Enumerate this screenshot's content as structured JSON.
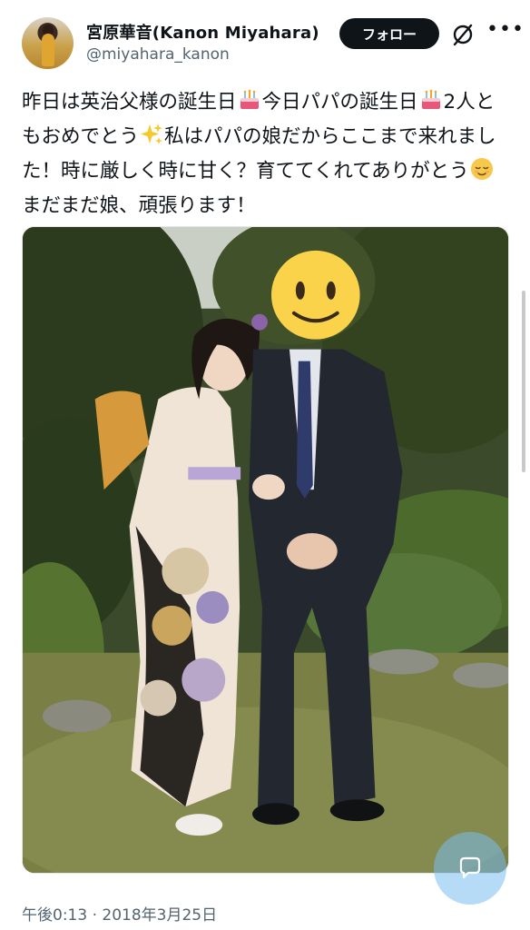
{
  "author": {
    "display_name": "宮原華音(Kanon Miyahara)",
    "handle": "@miyahara_kanon",
    "avatar_icon": "profile-photo"
  },
  "actions": {
    "follow_label": "フォロー",
    "grok_icon": "slash-circle-icon",
    "more_icon": "more-horizontal-icon"
  },
  "tweet": {
    "text_1": "昨日は英治父様の誕生日",
    "text_2": "今日パパの誕生日",
    "text_3": "2人ともおめでとう",
    "text_4": "私はパパの娘だからここまで来れました！時に厳しく時に甘く？育ててくれてありがとう",
    "text_5": "まだまだ娘、頑張ります！",
    "emoji_1": "birthday-cake-icon",
    "emoji_2": "birthday-cake-icon",
    "emoji_3": "sparkles-icon",
    "emoji_4": "relieved-face-icon"
  },
  "media": {
    "type": "photo",
    "face_overlay_icon": "smiley-face-icon"
  },
  "timestamp": "午後0:13 · 2018年3月25日",
  "fab_icon": "reply-bubble-icon",
  "colors": {
    "text": "#0f1419",
    "secondary": "#536471",
    "follow_bg": "#0f1419",
    "fab": "#78bef0"
  }
}
